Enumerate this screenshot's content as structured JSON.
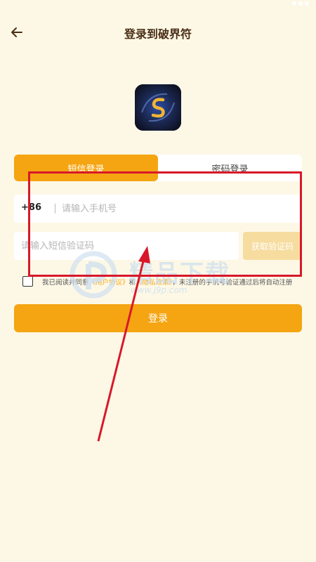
{
  "header": {
    "title": "登录到破界符",
    "back_icon": "back-arrow-icon"
  },
  "logo": {
    "icon": "app-logo-icon"
  },
  "tabs": [
    {
      "label": "短信登录",
      "active": true
    },
    {
      "label": "密码登录",
      "active": false
    }
  ],
  "phone_field": {
    "country_code": "+86",
    "placeholder": "请输入手机号",
    "value": ""
  },
  "code_field": {
    "placeholder": "请输入短信验证码",
    "value": "",
    "get_code_label": "获取验证码"
  },
  "agreement": {
    "prefix": "我已阅读并同意",
    "user_agreement": "《用户协议》",
    "conjunction": "和",
    "privacy_policy": "《隐私政策》",
    "suffix": "，未注册的手机号验证通过后将自动注册",
    "checked": false
  },
  "login_button": {
    "label": "登录"
  },
  "watermark": {
    "text": "精品下载",
    "url": "www.j9p.com"
  },
  "colors": {
    "background": "#fdf8e6",
    "accent": "#f5a512",
    "accent_disabled": "#f6dc9e",
    "title": "#4a2e16",
    "annotation": "#d8182a"
  }
}
